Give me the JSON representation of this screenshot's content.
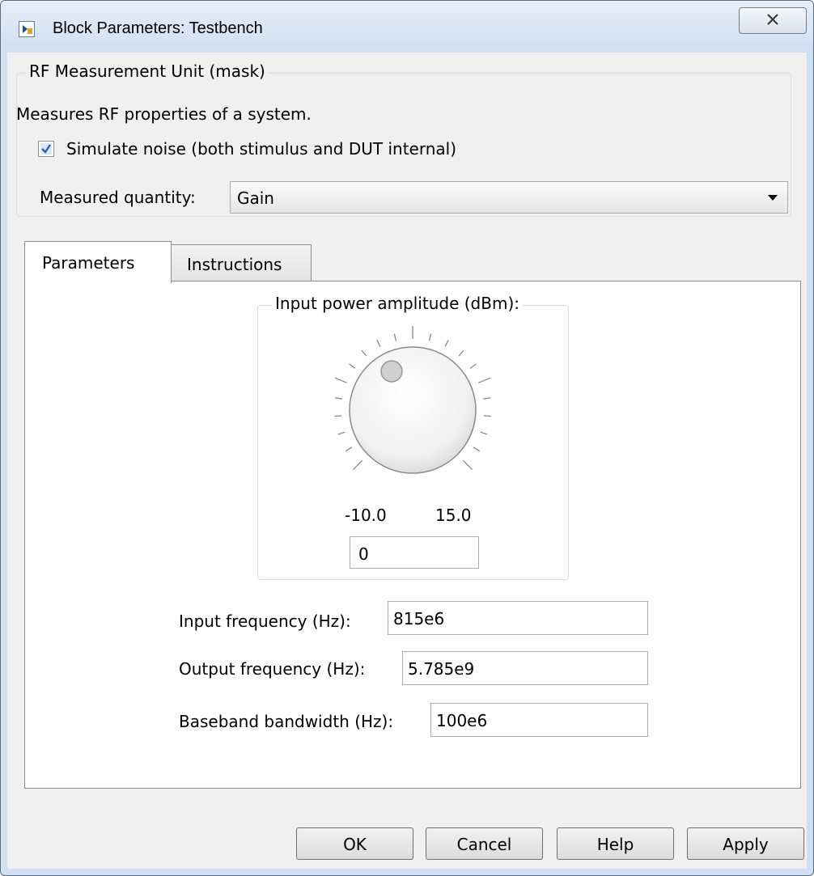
{
  "window": {
    "title": "Block Parameters: Testbench",
    "close_icon": "close-x-icon"
  },
  "mask": {
    "group_label": "RF Measurement Unit (mask)",
    "description": "Measures RF properties of a system.",
    "simulate_noise": {
      "label": "Simulate noise (both stimulus and DUT internal)",
      "checked": true
    },
    "measured_quantity": {
      "label": "Measured quantity:",
      "value": "Gain"
    }
  },
  "tabs": [
    {
      "label": "Parameters",
      "active": true
    },
    {
      "label": "Instructions",
      "active": false
    }
  ],
  "parameters": {
    "knob": {
      "label": "Input power amplitude (dBm):",
      "min_label": "-10.0",
      "max_label": "15.0",
      "value": "0"
    },
    "input_frequency": {
      "label": "Input frequency (Hz):",
      "value": "815e6"
    },
    "output_frequency": {
      "label": "Output frequency (Hz):",
      "value": "5.785e9"
    },
    "baseband_bandwidth": {
      "label": "Baseband bandwidth (Hz):",
      "value": "100e6"
    }
  },
  "buttons": {
    "ok": "OK",
    "cancel": "Cancel",
    "help": "Help",
    "apply": "Apply"
  },
  "colors": {
    "title_bar": "#cfdff0",
    "dialog_bg": "#f0f0f0",
    "panel_bg": "#ffffff",
    "checkbox_check": "#2a5fa8"
  }
}
